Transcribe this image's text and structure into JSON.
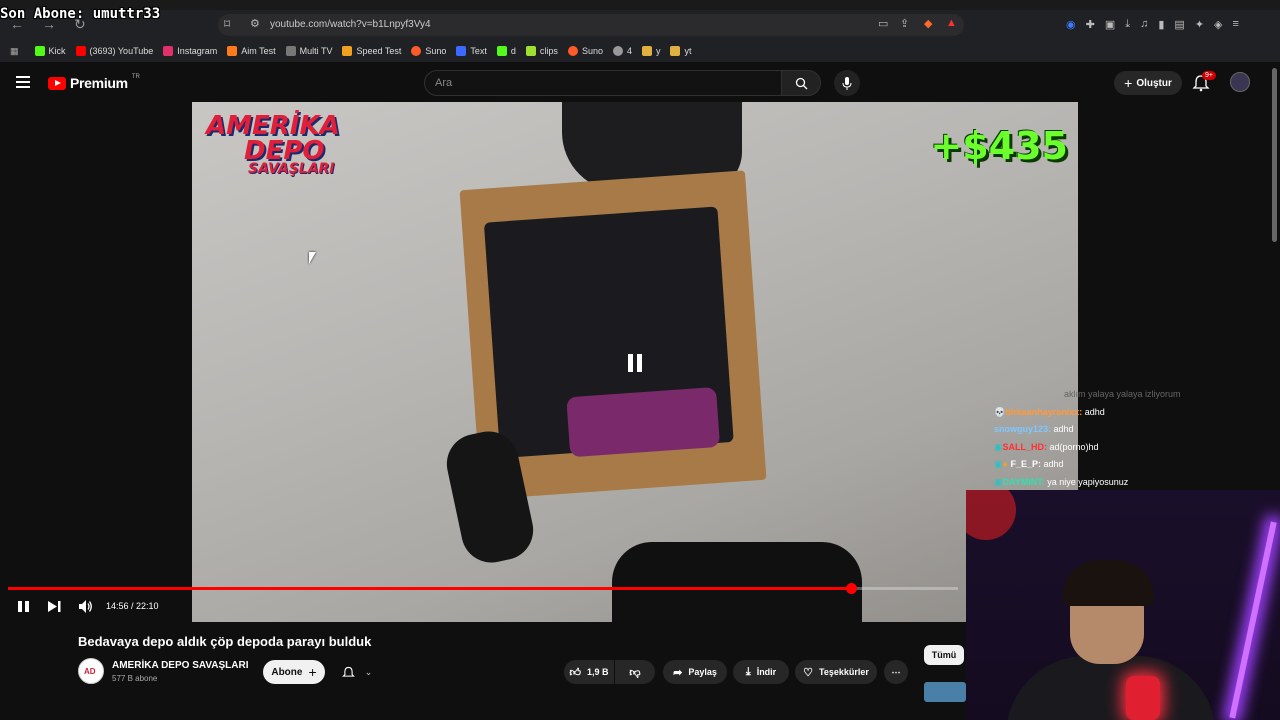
{
  "overlay": {
    "last_subscriber": "Son Abone: umuttr33"
  },
  "browser": {
    "url": "youtube.com/watch?v=b1Lnpyf3Vy4",
    "bookmarks": [
      {
        "label": "Kick",
        "color": "#53fc18"
      },
      {
        "label": "(3693) YouTube",
        "color": "#ff0000"
      },
      {
        "label": "Instagram",
        "color": "#e1306c"
      },
      {
        "label": "Aim Test",
        "color": "#ff7a1a"
      },
      {
        "label": "Multi TV",
        "color": "#777777"
      },
      {
        "label": "Speed Test",
        "color": "#f0a020"
      },
      {
        "label": "Suno",
        "color": "#ff5a2a"
      },
      {
        "label": "Text",
        "color": "#3a6aff"
      },
      {
        "label": "d",
        "color": "#53fc18"
      },
      {
        "label": "clips",
        "color": "#a0e030"
      },
      {
        "label": "Suno",
        "color": "#ff5a2a"
      },
      {
        "label": "4",
        "color": "#999999"
      },
      {
        "label": "y",
        "color": "#e0b040"
      },
      {
        "label": "yt",
        "color": "#e0b040"
      }
    ]
  },
  "youtube": {
    "logo_text": "Premium",
    "region": "TR",
    "search_placeholder": "Ara",
    "create_label": "Oluştur",
    "notif_badge": "9+"
  },
  "video": {
    "overlay_brand": {
      "line1": "AMERİKA",
      "line2": "DEPO",
      "line3": "SAVAŞLARI"
    },
    "overlay_money": "+$435",
    "current_time": "14:56",
    "duration": "22:10",
    "progress": 0.887,
    "time_display": "14:56 / 22:10"
  },
  "chat": {
    "faded_line": "aklım yalaya yalaya izliyorum",
    "messages": [
      {
        "user": "birkaanhayranixx:",
        "text": "adhd",
        "color": "#ff9a3c"
      },
      {
        "user": "snowguy123:",
        "text": "adhd",
        "color": "#7fc8ff"
      },
      {
        "user": "SALL_HD:",
        "text": "ad(porno)hd",
        "color": "#ff3030"
      },
      {
        "user": "F_E_P:",
        "text": "adhd",
        "color": "#ffffff"
      },
      {
        "user": "DAYMINT:",
        "text": "ya niye yapiyosunuz",
        "color": "#30e0b0"
      }
    ]
  },
  "info": {
    "title": "Bedavaya depo aldık çöp depoda parayı bulduk",
    "channel_name": "AMERİKA DEPO SAVAŞLARI",
    "subscribers": "577 B abone",
    "subscribe_label": "Abone",
    "likes": "1,9 B",
    "share_label": "Paylaş",
    "download_label": "İndir",
    "thanks_label": "Teşekkürler",
    "all_chip": "Tümü"
  }
}
